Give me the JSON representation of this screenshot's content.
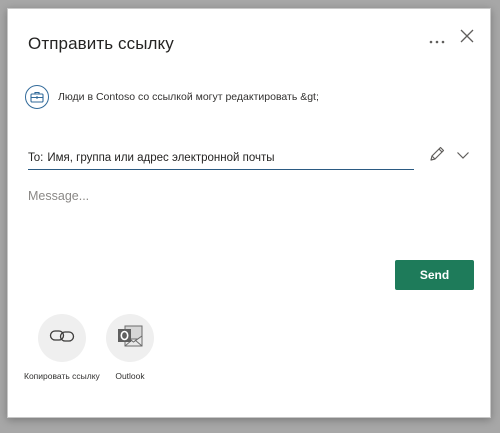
{
  "dialog": {
    "title": "Отправить ссылку",
    "more_icon": "more-horizontal-icon",
    "close_icon": "close-icon"
  },
  "permission": {
    "icon": "briefcase-icon",
    "text": "Люди в Contoso со ссылкой могут редактировать &gt;"
  },
  "to_field": {
    "label": "To:",
    "placeholder": "Имя, группа или адрес электронной почты",
    "value": ""
  },
  "edit_control": {
    "pencil_icon": "pencil-icon",
    "chevron_icon": "chevron-down-icon"
  },
  "message": {
    "placeholder": "Message...",
    "value": ""
  },
  "send_button": {
    "label": "Send"
  },
  "share_options": [
    {
      "label": "Копировать ссылку",
      "icon": "link-icon"
    },
    {
      "label": "Outlook",
      "icon": "outlook-icon"
    }
  ],
  "colors": {
    "accent": "#1e7b5a",
    "input_underline": "#2b5a82",
    "permission_icon": "#316a9a",
    "backdrop": "#a7a7a7"
  }
}
